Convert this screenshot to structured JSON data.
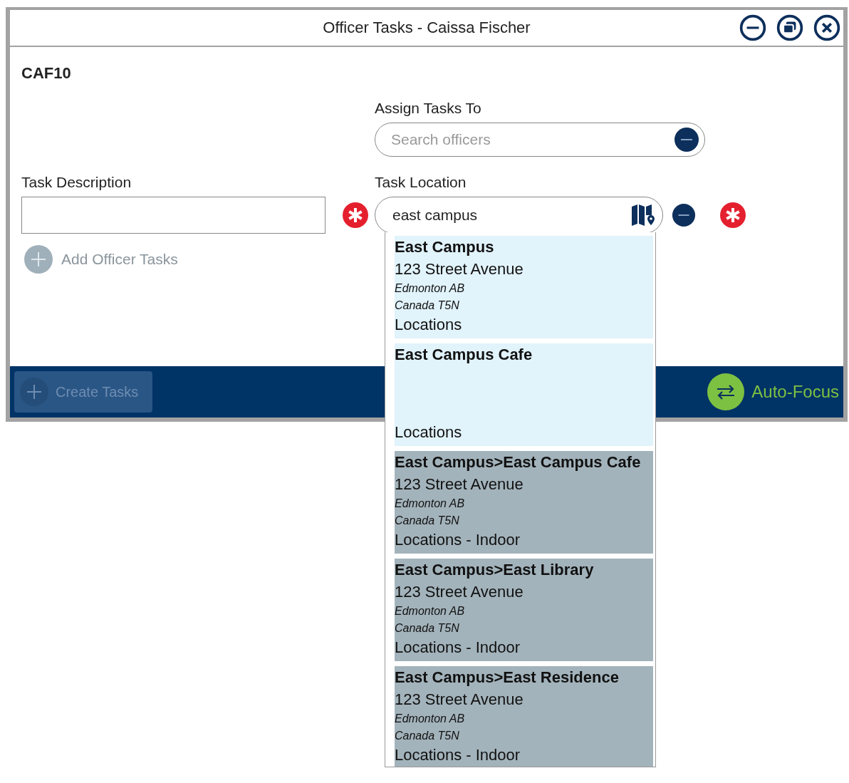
{
  "window": {
    "title": "Officer Tasks - Caissa Fischer"
  },
  "code": "CAF10",
  "assign": {
    "label": "Assign Tasks To",
    "placeholder": "Search officers"
  },
  "task_description": {
    "label": "Task Description",
    "required": true
  },
  "task_location": {
    "label": "Task Location",
    "value": "east campus",
    "required": true
  },
  "add_button": {
    "label": "Add Officer Tasks",
    "disabled": true
  },
  "create_button": {
    "label": "Create Tasks",
    "disabled": true
  },
  "auto_focus": {
    "label": "Auto-Focus"
  },
  "suggestions": [
    {
      "name": "East Campus",
      "address": "123 Street Avenue",
      "city": "Edmonton AB",
      "country": "Canada T5N",
      "category": "Locations",
      "highlighted": true
    },
    {
      "name": "East Campus Cafe",
      "category": "Locations",
      "highlighted": true
    },
    {
      "name": "East Campus>East Campus Cafe",
      "address": "123 Street Avenue",
      "city": "Edmonton AB",
      "country": "Canada T5N",
      "category": "Locations - Indoor",
      "highlighted": false
    },
    {
      "name": "East Campus>East Library",
      "address": "123 Street Avenue",
      "city": "Edmonton AB",
      "country": "Canada T5N",
      "category": "Locations - Indoor",
      "highlighted": false
    },
    {
      "name": "East Campus>East Residence",
      "address": "123 Street Avenue",
      "city": "Edmonton AB",
      "country": "Canada T5N",
      "category": "Locations - Indoor",
      "highlighted": false
    }
  ]
}
